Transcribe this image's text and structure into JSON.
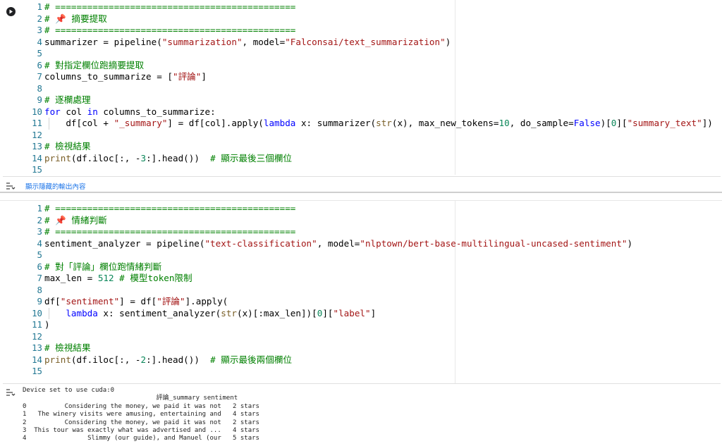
{
  "cell1": {
    "lines": [
      {
        "n": "1",
        "parts": [
          [
            "cmt",
            "# ============================================="
          ]
        ]
      },
      {
        "n": "2",
        "parts": [
          [
            "cmt",
            "# 📌 摘要提取"
          ]
        ]
      },
      {
        "n": "3",
        "parts": [
          [
            "cmt",
            "# ============================================="
          ]
        ]
      },
      {
        "n": "4",
        "parts": [
          [
            "",
            "summarizer = pipeline("
          ],
          [
            "str",
            "\"summarization\""
          ],
          [
            "",
            ", model="
          ],
          [
            "str",
            "\"Falconsai/text_summarization\""
          ],
          [
            "",
            ")"
          ]
        ]
      },
      {
        "n": "5",
        "parts": [
          [
            "",
            ""
          ]
        ]
      },
      {
        "n": "6",
        "parts": [
          [
            "cmt",
            "# 對指定欄位跑摘要提取"
          ]
        ]
      },
      {
        "n": "7",
        "parts": [
          [
            "",
            "columns_to_summarize = ["
          ],
          [
            "str",
            "\"評論\""
          ],
          [
            "",
            "]"
          ]
        ]
      },
      {
        "n": "8",
        "parts": [
          [
            "",
            ""
          ]
        ]
      },
      {
        "n": "9",
        "parts": [
          [
            "cmt",
            "# 逐欄處理"
          ]
        ]
      },
      {
        "n": "10",
        "parts": [
          [
            "kw",
            "for"
          ],
          [
            "",
            " col "
          ],
          [
            "kw",
            "in"
          ],
          [
            "",
            " columns_to_summarize:"
          ]
        ]
      },
      {
        "n": "11",
        "parts": [
          [
            "",
            "    df[col + "
          ],
          [
            "str",
            "\"_summary\""
          ],
          [
            "",
            "] = df[col].apply("
          ],
          [
            "kw",
            "lambda"
          ],
          [
            "",
            " x: summarizer("
          ],
          [
            "fn",
            "str"
          ],
          [
            "",
            "(x), max_new_tokens="
          ],
          [
            "num",
            "10"
          ],
          [
            "",
            ", do_sample="
          ],
          [
            "kw",
            "False"
          ],
          [
            "",
            ")["
          ],
          [
            "num",
            "0"
          ],
          [
            "",
            "]["
          ],
          [
            "str",
            "\"summary_text\""
          ],
          [
            "",
            "])"
          ]
        ]
      },
      {
        "n": "12",
        "parts": [
          [
            "",
            ""
          ]
        ]
      },
      {
        "n": "13",
        "parts": [
          [
            "cmt",
            "# 檢視結果"
          ]
        ]
      },
      {
        "n": "14",
        "parts": [
          [
            "fn",
            "print"
          ],
          [
            "",
            "(df.iloc[:, -"
          ],
          [
            "num",
            "3"
          ],
          [
            "",
            ":].head())  "
          ],
          [
            "cmt",
            "# 顯示最後三個欄位"
          ]
        ]
      },
      {
        "n": "15",
        "parts": [
          [
            "",
            ""
          ]
        ]
      }
    ],
    "output_toggle_label": "顯示隱藏的輸出內容"
  },
  "cell2": {
    "lines": [
      {
        "n": "1",
        "parts": [
          [
            "cmt",
            "# ============================================="
          ]
        ]
      },
      {
        "n": "2",
        "parts": [
          [
            "cmt",
            "# 📌 情緒判斷"
          ]
        ]
      },
      {
        "n": "3",
        "parts": [
          [
            "cmt",
            "# ============================================="
          ]
        ]
      },
      {
        "n": "4",
        "parts": [
          [
            "",
            "sentiment_analyzer = pipeline("
          ],
          [
            "str",
            "\"text-classification\""
          ],
          [
            "",
            ", model="
          ],
          [
            "str",
            "\"nlptown/bert-base-multilingual-uncased-sentiment\""
          ],
          [
            "",
            ")"
          ]
        ]
      },
      {
        "n": "5",
        "parts": [
          [
            "",
            ""
          ]
        ]
      },
      {
        "n": "6",
        "parts": [
          [
            "cmt",
            "# 對「評論」欄位跑情緒判斷"
          ]
        ]
      },
      {
        "n": "7",
        "parts": [
          [
            "",
            "max_len = "
          ],
          [
            "num",
            "512"
          ],
          [
            "",
            " "
          ],
          [
            "cmt",
            "# 模型token限制"
          ]
        ]
      },
      {
        "n": "8",
        "parts": [
          [
            "",
            ""
          ]
        ]
      },
      {
        "n": "9",
        "parts": [
          [
            "",
            "df["
          ],
          [
            "str",
            "\"sentiment\""
          ],
          [
            "",
            "] = df["
          ],
          [
            "str",
            "\"評論\""
          ],
          [
            "",
            "].apply("
          ]
        ]
      },
      {
        "n": "10",
        "parts": [
          [
            "",
            "    "
          ],
          [
            "kw",
            "lambda"
          ],
          [
            "",
            " x: sentiment_analyzer("
          ],
          [
            "fn",
            "str"
          ],
          [
            "",
            "(x)[:max_len])["
          ],
          [
            "num",
            "0"
          ],
          [
            "",
            "]["
          ],
          [
            "str",
            "\"label\""
          ],
          [
            "",
            "]"
          ]
        ]
      },
      {
        "n": "11",
        "parts": [
          [
            "",
            ")"
          ]
        ]
      },
      {
        "n": "12",
        "parts": [
          [
            "",
            ""
          ]
        ]
      },
      {
        "n": "13",
        "parts": [
          [
            "cmt",
            "# 檢視結果"
          ]
        ]
      },
      {
        "n": "14",
        "parts": [
          [
            "fn",
            "print"
          ],
          [
            "",
            "(df.iloc[:, -"
          ],
          [
            "num",
            "2"
          ],
          [
            "",
            ":].head())  "
          ],
          [
            "cmt",
            "# 顯示最後兩個欄位"
          ]
        ]
      },
      {
        "n": "15",
        "parts": [
          [
            "",
            ""
          ]
        ]
      }
    ],
    "output_lines": [
      "Device set to use cuda:0",
      "                                   評論_summary sentiment",
      "0          Considering the money, we paid it was not   2 stars",
      "1   The winery visits were amusing, entertaining and   4 stars",
      "2          Considering the money, we paid it was not   2 stars",
      "3  This tour was exactly what was advertised and ...   4 stars",
      "4                Slimmy (our guide), and Manuel (our   5 stars"
    ]
  }
}
